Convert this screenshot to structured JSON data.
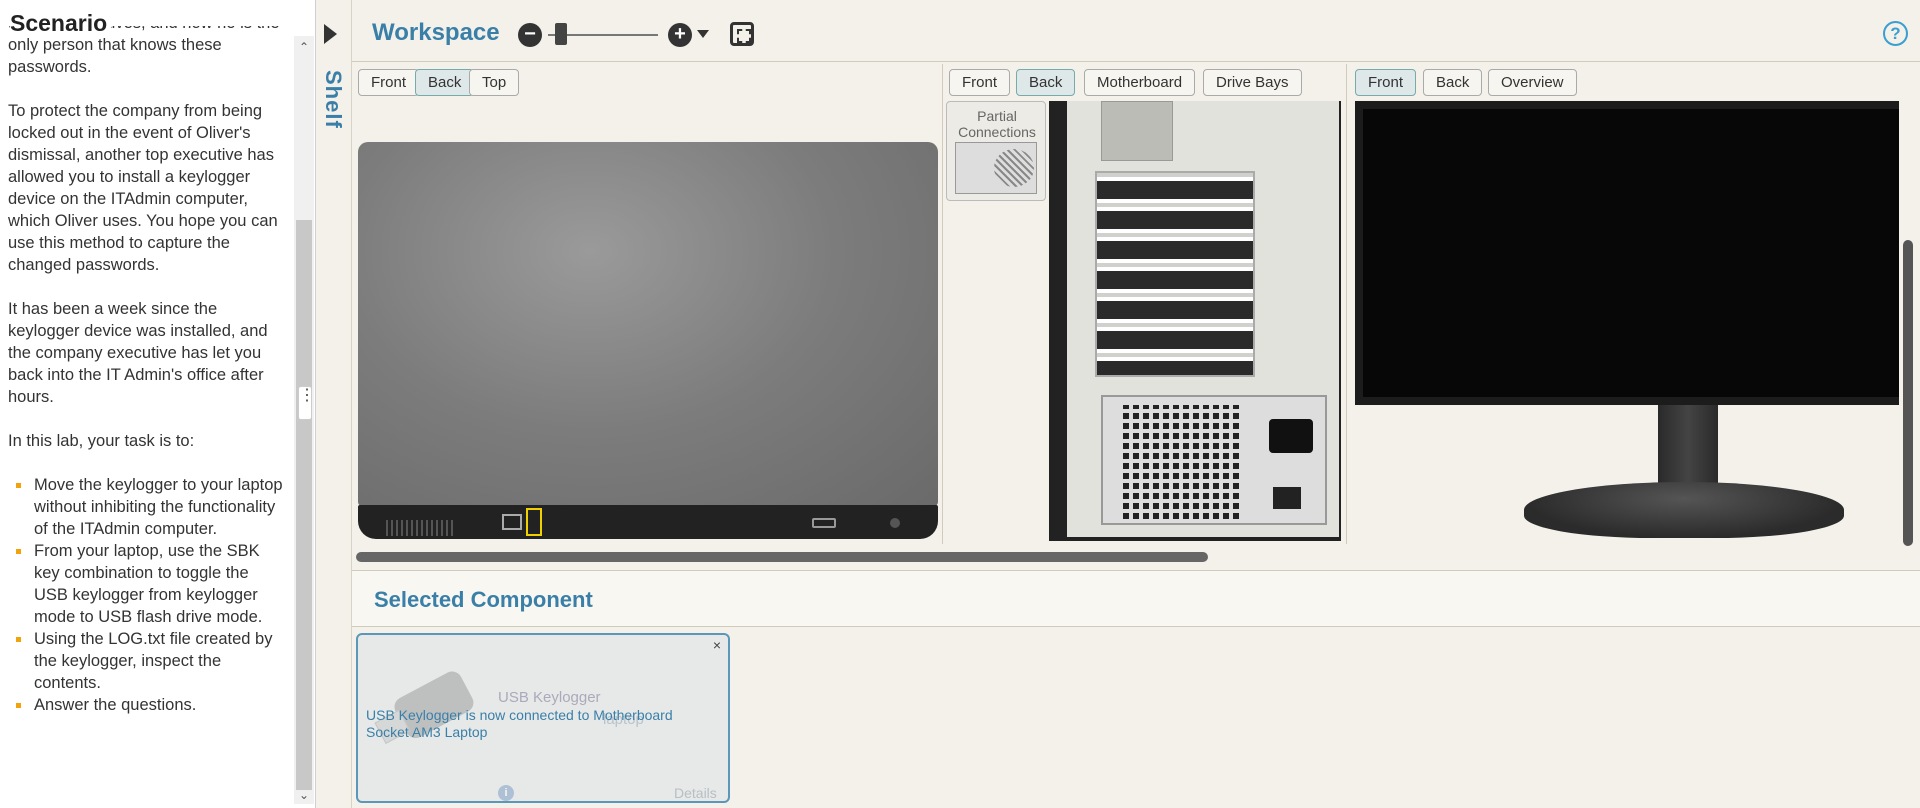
{
  "scenario": {
    "title": "Scenario",
    "paragraphs": [
      "the top executives, and how he is the only person that knows these passwords.",
      "To protect the company from being locked out in the event of Oliver's dismissal, another top executive has allowed you to install a keylogger device on the ITAdmin computer, which Oliver uses. You hope you can use this method to capture the changed passwords.",
      "It has been a week since the keylogger device was installed, and the company executive has let you back into the IT Admin's office after hours.",
      "In this lab, your task is to:"
    ],
    "tasks": [
      "Move the keylogger to your laptop without inhibiting the functionality of the ITAdmin computer.",
      "From your laptop, use the SBK key combination to toggle the USB keylogger from keylogger mode to USB flash drive mode.",
      "Using the LOG.txt file created by the keylogger, inspect the contents.",
      "Answer the questions."
    ]
  },
  "shelf": {
    "label": "Shelf"
  },
  "workspace": {
    "title": "Workspace",
    "zoom_out_symbol": "−",
    "zoom_in_symbol": "+",
    "help_symbol": "?",
    "zoom_level": 0.12,
    "laptop_tabs": [
      "Front",
      "Back",
      "Top"
    ],
    "laptop_active": "Back",
    "tower_tabs": [
      "Front",
      "Back",
      "Motherboard",
      "Drive Bays"
    ],
    "tower_active": "Back",
    "monitor_tabs": [
      "Front",
      "Back",
      "Overview"
    ],
    "monitor_active": "Front",
    "partial_connections": "Partial Connections"
  },
  "selected_component": {
    "title": "Selected Component",
    "name": "USB Keylogger",
    "sub": "laptop",
    "message": "USB Keylogger is now connected to Motherboard Socket AM3 Laptop",
    "info_symbol": "i",
    "details_label": "Details",
    "close_symbol": "×"
  },
  "colors": {
    "accent": "#3a7fa8",
    "selected_port": "#f0d000",
    "bullet": "#f0a30a"
  }
}
